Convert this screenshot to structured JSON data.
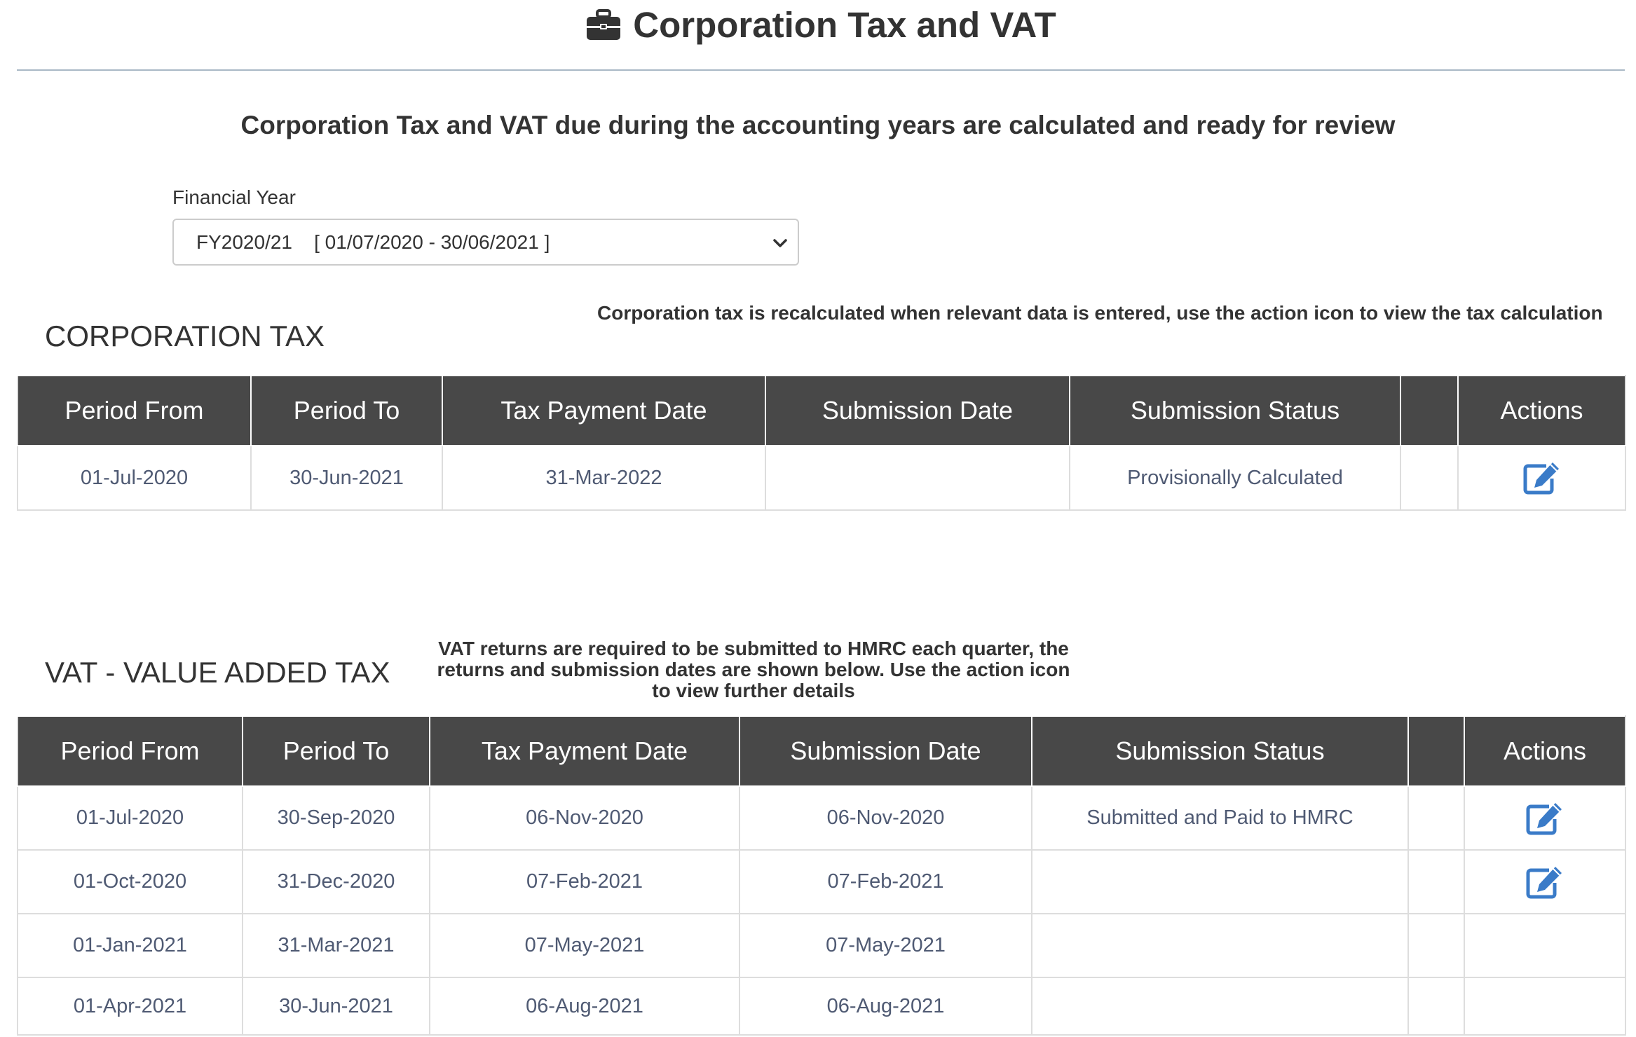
{
  "header": {
    "title": "Corporation Tax and VAT",
    "icon": "briefcase-icon"
  },
  "subtitle": "Corporation Tax and VAT due during the accounting years are calculated and ready for review",
  "financial_year": {
    "label": "Financial Year",
    "selected": "FY2020/21    [ 01/07/2020 - 30/06/2021 ]"
  },
  "corporation_tax": {
    "title": "CORPORATION TAX",
    "note": "Corporation tax is recalculated when relevant data is entered, use the action icon to view the tax calculation",
    "columns": [
      "Period From",
      "Period To",
      "Tax Payment Date",
      "Submission Date",
      "Submission Status",
      "",
      "Actions"
    ],
    "rows": [
      {
        "period_from": "01-Jul-2020",
        "period_to": "30-Jun-2021",
        "tax_payment_date": "31-Mar-2022",
        "submission_date": "",
        "status": "Provisionally Calculated",
        "extra": "",
        "has_action": true
      }
    ]
  },
  "vat": {
    "title": "VAT - VALUE ADDED TAX",
    "note_lines": [
      "VAT returns are required to be submitted to HMRC each quarter, the",
      "returns and submission dates are shown below. Use the action icon",
      "to view further details"
    ],
    "columns": [
      "Period From",
      "Period To",
      "Tax Payment Date",
      "Submission Date",
      "Submission Status",
      "",
      "Actions"
    ],
    "rows": [
      {
        "period_from": "01-Jul-2020",
        "period_to": "30-Sep-2020",
        "tax_payment_date": "06-Nov-2020",
        "submission_date": "06-Nov-2020",
        "status": "Submitted and Paid to HMRC",
        "extra": "",
        "has_action": true
      },
      {
        "period_from": "01-Oct-2020",
        "period_to": "31-Dec-2020",
        "tax_payment_date": "07-Feb-2021",
        "submission_date": "07-Feb-2021",
        "status": "",
        "extra": "",
        "has_action": true
      },
      {
        "period_from": "01-Jan-2021",
        "period_to": "31-Mar-2021",
        "tax_payment_date": "07-May-2021",
        "submission_date": "07-May-2021",
        "status": "",
        "extra": "",
        "has_action": false
      },
      {
        "period_from": "01-Apr-2021",
        "period_to": "30-Jun-2021",
        "tax_payment_date": "06-Aug-2021",
        "submission_date": "06-Aug-2021",
        "status": "",
        "extra": "",
        "has_action": false
      }
    ]
  },
  "colors": {
    "header_bg": "#484848",
    "icon_blue": "#3a7bc8",
    "cell_text": "#4f5a73"
  }
}
